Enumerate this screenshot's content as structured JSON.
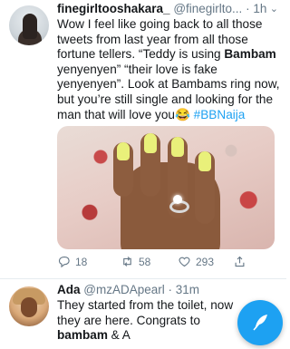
{
  "tweet1": {
    "name": "finegirltooshakara_",
    "handle": "@finegirlto...",
    "time": "1h",
    "text_parts": {
      "p1": "Wow I feel like going back to all those tweets from last year from all those fortune tellers. “Teddy is using ",
      "b1": "Bambam",
      "p2": " yenyenyen” “their love is fake yenyenyen”. Look at Bambams ring now, but you’re still single and looking for the man that will love you",
      "emoji": "😂",
      "hashtag": " #BBNaija"
    },
    "counts": {
      "replies": "18",
      "retweets": "58",
      "likes": "293"
    }
  },
  "tweet2": {
    "name": "Ada",
    "handle": "@mzADApearl",
    "time": "31m",
    "text_parts": {
      "p1": "They started from the toilet, now they are here. Congrats to ",
      "b1": "bambam",
      "p2": " & A"
    }
  },
  "icons": {
    "reply": "reply-icon",
    "retweet": "retweet-icon",
    "like": "heart-icon",
    "share": "share-icon",
    "caret": "chevron-down-icon",
    "compose": "compose-feather-icon"
  },
  "colors": {
    "accent": "#1da1f2",
    "muted": "#657786",
    "text": "#14171a"
  }
}
